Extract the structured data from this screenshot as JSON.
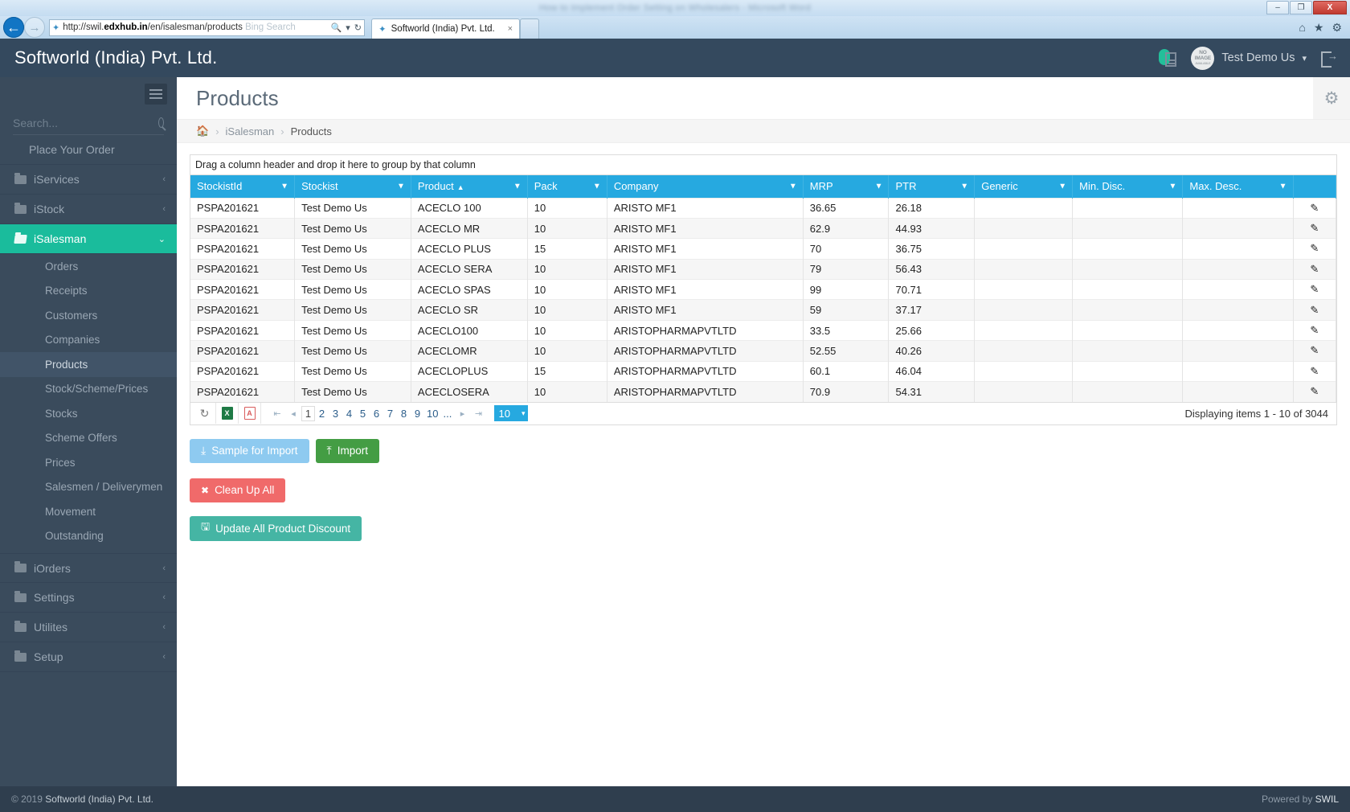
{
  "browser": {
    "bg_window_title": "How to Implement Order Setting on Wholesalers - Microsoft Word",
    "window_buttons": {
      "minimize": "–",
      "maximize": "❐",
      "close": "X"
    },
    "back_label": "←",
    "forward_label": "→",
    "url_prefix": "http://swil.",
    "url_bold": "edxhub.in",
    "url_suffix": "/en/isalesman/products",
    "url_dim_text": "Bing  Search",
    "search_icon": "search-icon",
    "refresh_icon": "refresh-icon",
    "tab_title": "Softworld (India) Pvt. Ltd.",
    "tab_close": "×",
    "home_icon": "⌂",
    "favorites_icon": "★",
    "settings_icon": "⚙"
  },
  "topbar": {
    "brand": "Softworld (India) Pvt. Ltd.",
    "notification_icon": "clipboard-notification-icon",
    "avatar_line1": "NO",
    "avatar_line2": "IMAGE",
    "avatar_line3": "AVAILABLE",
    "user_name": "Test Demo Us",
    "caret": "▾",
    "logout_icon": "logout-icon"
  },
  "sidebar": {
    "toggle_icon": "hamburger-icon",
    "search_placeholder": "Search...",
    "search_value": "",
    "items": [
      {
        "label": "Place Your Order",
        "type": "plain"
      },
      {
        "label": "iServices",
        "type": "folder",
        "chevron": "‹"
      },
      {
        "label": "iStock",
        "type": "folder",
        "chevron": "‹"
      },
      {
        "label": "iSalesman",
        "type": "folder",
        "chevron": "⌄",
        "active": true
      }
    ],
    "subitems": [
      {
        "label": "Orders"
      },
      {
        "label": "Receipts"
      },
      {
        "label": "Customers"
      },
      {
        "label": "Companies"
      },
      {
        "label": "Products",
        "current": true
      },
      {
        "label": "Stock/Scheme/Prices"
      },
      {
        "label": "Stocks"
      },
      {
        "label": "Scheme Offers"
      },
      {
        "label": "Prices"
      },
      {
        "label": "Salesmen / Deliverymen"
      },
      {
        "label": "Movement"
      },
      {
        "label": "Outstanding"
      }
    ],
    "items_bottom": [
      {
        "label": "iOrders",
        "chevron": "‹"
      },
      {
        "label": "Settings",
        "chevron": "‹"
      },
      {
        "label": "Utilites",
        "chevron": "‹"
      },
      {
        "label": "Setup",
        "chevron": "‹"
      }
    ]
  },
  "page": {
    "title": "Products",
    "gear_icon": "gear-icon",
    "breadcrumb": {
      "home_icon": "home-icon",
      "sep": "›",
      "link": "iSalesman",
      "current": "Products"
    }
  },
  "grid": {
    "group_hint": "Drag a column header and drop it here to group by that column",
    "sort_indicator": "▲",
    "filter_icon": "filter-icon",
    "columns": [
      {
        "label": "StockistId",
        "width": "8.5%"
      },
      {
        "label": "Stockist",
        "width": "9.5%"
      },
      {
        "label": "Product",
        "width": "9.5%",
        "sorted": "asc"
      },
      {
        "label": "Pack",
        "width": "6.5%"
      },
      {
        "label": "Company",
        "width": "16%"
      },
      {
        "label": "MRP",
        "width": "7%"
      },
      {
        "label": "PTR",
        "width": "7%"
      },
      {
        "label": "Generic",
        "width": "8%"
      },
      {
        "label": "Min. Disc.",
        "width": "9%"
      },
      {
        "label": "Max. Desc.",
        "width": "9%"
      },
      {
        "label": "",
        "width": "4%"
      }
    ],
    "edit_icon": "pencil-edit-icon",
    "rows": [
      {
        "stockist_id": "PSPA201621",
        "stockist": "Test Demo Us",
        "product": "ACECLO 100",
        "pack": "10",
        "company": "ARISTO MF1",
        "mrp": "36.65",
        "ptr": "26.18",
        "generic": "",
        "min_disc": "",
        "max_desc": ""
      },
      {
        "stockist_id": "PSPA201621",
        "stockist": "Test Demo Us",
        "product": "ACECLO MR",
        "pack": "10",
        "company": "ARISTO MF1",
        "mrp": "62.9",
        "ptr": "44.93",
        "generic": "",
        "min_disc": "",
        "max_desc": ""
      },
      {
        "stockist_id": "PSPA201621",
        "stockist": "Test Demo Us",
        "product": "ACECLO PLUS",
        "pack": "15",
        "company": "ARISTO MF1",
        "mrp": "70",
        "ptr": "36.75",
        "generic": "",
        "min_disc": "",
        "max_desc": ""
      },
      {
        "stockist_id": "PSPA201621",
        "stockist": "Test Demo Us",
        "product": "ACECLO SERA",
        "pack": "10",
        "company": "ARISTO MF1",
        "mrp": "79",
        "ptr": "56.43",
        "generic": "",
        "min_disc": "",
        "max_desc": ""
      },
      {
        "stockist_id": "PSPA201621",
        "stockist": "Test Demo Us",
        "product": "ACECLO SPAS",
        "pack": "10",
        "company": "ARISTO MF1",
        "mrp": "99",
        "ptr": "70.71",
        "generic": "",
        "min_disc": "",
        "max_desc": ""
      },
      {
        "stockist_id": "PSPA201621",
        "stockist": "Test Demo Us",
        "product": "ACECLO SR",
        "pack": "10",
        "company": "ARISTO MF1",
        "mrp": "59",
        "ptr": "37.17",
        "generic": "",
        "min_disc": "",
        "max_desc": ""
      },
      {
        "stockist_id": "PSPA201621",
        "stockist": "Test Demo Us",
        "product": "ACECLO100",
        "pack": "10",
        "company": "ARISTOPHARMAPVTLTD",
        "mrp": "33.5",
        "ptr": "25.66",
        "generic": "",
        "min_disc": "",
        "max_desc": ""
      },
      {
        "stockist_id": "PSPA201621",
        "stockist": "Test Demo Us",
        "product": "ACECLOMR",
        "pack": "10",
        "company": "ARISTOPHARMAPVTLTD",
        "mrp": "52.55",
        "ptr": "40.26",
        "generic": "",
        "min_disc": "",
        "max_desc": ""
      },
      {
        "stockist_id": "PSPA201621",
        "stockist": "Test Demo Us",
        "product": "ACECLOPLUS",
        "pack": "15",
        "company": "ARISTOPHARMAPVTLTD",
        "mrp": "60.1",
        "ptr": "46.04",
        "generic": "",
        "min_disc": "",
        "max_desc": ""
      },
      {
        "stockist_id": "PSPA201621",
        "stockist": "Test Demo Us",
        "product": "ACECLOSERA",
        "pack": "10",
        "company": "ARISTOPHARMAPVTLTD",
        "mrp": "70.9",
        "ptr": "54.31",
        "generic": "",
        "min_disc": "",
        "max_desc": ""
      }
    ],
    "pager": {
      "refresh_icon": "refresh-icon",
      "excel_icon": "excel-export-icon",
      "excel_label": "X",
      "pdf_icon": "pdf-export-icon",
      "pdf_label": "A",
      "first": "⏮",
      "prev": "◂",
      "next": "▸",
      "last": "⏭",
      "pages": [
        "1",
        "2",
        "3",
        "4",
        "5",
        "6",
        "7",
        "8",
        "9",
        "10",
        "..."
      ],
      "active_page": "1",
      "page_size": "10",
      "page_size_caret": "▾",
      "info": "Displaying items 1 - 10 of 3044"
    }
  },
  "actions": {
    "sample_for_import": "Sample for Import",
    "import": "Import",
    "clean_up_all": "Clean Up All",
    "update_all_product_discount": "Update All Product Discount"
  },
  "footer": {
    "copyright_prefix": "© 2019 ",
    "copyright_brand": "Softworld (India) Pvt. Ltd.",
    "powered_prefix": "Powered by ",
    "powered_brand": "SWIL"
  }
}
